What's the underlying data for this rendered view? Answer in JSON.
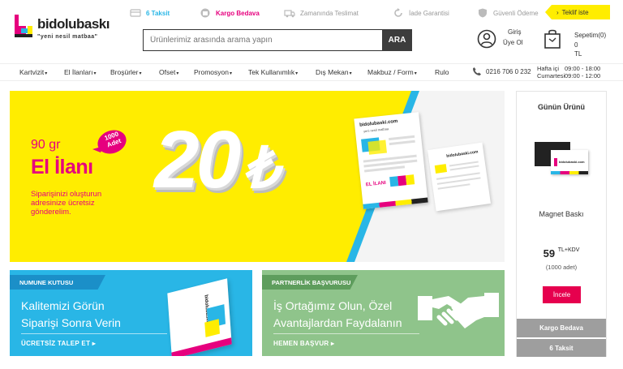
{
  "top_features": [
    {
      "label": "6 Taksit",
      "icon": "card-icon"
    },
    {
      "label": "Kargo Bedava",
      "icon": "gift-icon"
    },
    {
      "label": "Zamanında Teslimat",
      "icon": "truck-icon"
    },
    {
      "label": "İade Garantisi",
      "icon": "return-icon"
    },
    {
      "label": "Güvenli Ödeme",
      "icon": "shield-icon"
    }
  ],
  "teklif": "Teklif iste",
  "logo": {
    "name": "bidolubaskı",
    "tagline": "\"yeni nesil matbaa\""
  },
  "search": {
    "placeholder": "Ürünlerimiz arasında arama yapın",
    "button": "ARA"
  },
  "account": {
    "line1": "Giriş",
    "line2": "Üye Ol"
  },
  "cart": {
    "label": "Sepetim(0)",
    "total": "0 TL"
  },
  "nav": {
    "items": [
      "Kartvizit",
      "El İlanları",
      "Broşürler",
      "Ofset",
      "Promosyon",
      "Tek Kullanımlık",
      "Dış Mekan",
      "Makbuz / Form",
      "Rulo"
    ],
    "phone": "0216 706 0 232",
    "hours": [
      {
        "days": "Hafta içi",
        "time": "09:00 - 18:00"
      },
      {
        "days": "Cumartesi",
        "time": "09:00 - 12:00"
      }
    ]
  },
  "banner": {
    "weight": "90 gr",
    "product": "El İlanı",
    "badge_qty": "1000",
    "badge_unit": "Adet",
    "note": "Siparişinizi oluşturun adresinize ücretsiz gönderelim.",
    "price": "20",
    "currency": "₺",
    "flyer_brand": "bidolubaski.com",
    "flyer_tagline": "yeni nesil matbaa",
    "flyer_title": "EL İLANI",
    "flyer_back_brand": "bidolubaski.com"
  },
  "cards": [
    {
      "tag": "NUMUNE KUTUSU",
      "headline1": "Kalitemizi Görün",
      "headline2": "Siparişi Sonra Verin",
      "cta": "ÜCRETSİZ TALEP ET",
      "sample_brand": "bidolubaski.com"
    },
    {
      "tag": "PARTNERLİK BAŞVURUSU",
      "headline1": "İş Ortağımız Olun, Özel",
      "headline2": "Avantajlardan Faydalanın",
      "cta": "HEMEN BAŞVUR"
    }
  ],
  "side": {
    "title": "Günün Ürünü",
    "product_brand": "bidolubaski.com",
    "product": "Magnet Baskı",
    "price": "59",
    "price_suffix": "TL+KDV",
    "qty": "(1000 adet)",
    "button": "İncele",
    "bars": [
      "Kargo Bedava",
      "6 Taksit"
    ]
  },
  "colors": {
    "brand_pink": "#e6007e",
    "brand_yellow": "#ffed00",
    "cta_red": "#e6004e",
    "card_blue": "#29b6e6",
    "card_green": "#8fc48b"
  }
}
